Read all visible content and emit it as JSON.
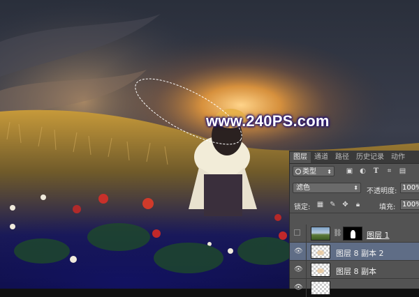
{
  "watermark": "www.240PS.com",
  "panel": {
    "tabs": [
      {
        "label": "图层",
        "active": true
      },
      {
        "label": "通道",
        "active": false
      },
      {
        "label": "路径",
        "active": false
      },
      {
        "label": "历史记录",
        "active": false
      },
      {
        "label": "动作",
        "active": false
      }
    ],
    "filter": {
      "kind_label": "类型",
      "icons": [
        "image-filter-icon",
        "adjustment-filter-icon",
        "type-filter-icon",
        "shape-filter-icon",
        "smart-object-filter-icon"
      ]
    },
    "blend_mode": "滤色",
    "opacity_label": "不透明度:",
    "opacity_value": "100%",
    "lock_label": "锁定:",
    "lock_icons": [
      "lock-transparent-icon",
      "lock-pixels-icon",
      "lock-position-icon",
      "lock-all-icon"
    ],
    "fill_label": "填充:",
    "fill_value": "100%",
    "layers": [
      {
        "name": "图层 1",
        "visible": false,
        "selected": false,
        "has_mask": true
      },
      {
        "name": "图层 8 副本 2",
        "visible": true,
        "selected": true,
        "has_mask": false
      },
      {
        "name": "图层 8 副本",
        "visible": true,
        "selected": false,
        "has_mask": false
      }
    ]
  },
  "colors": {
    "panel_bg": "#535353",
    "selected_row": "#5f6d86",
    "watermark_glow": "#2a1a7a"
  }
}
